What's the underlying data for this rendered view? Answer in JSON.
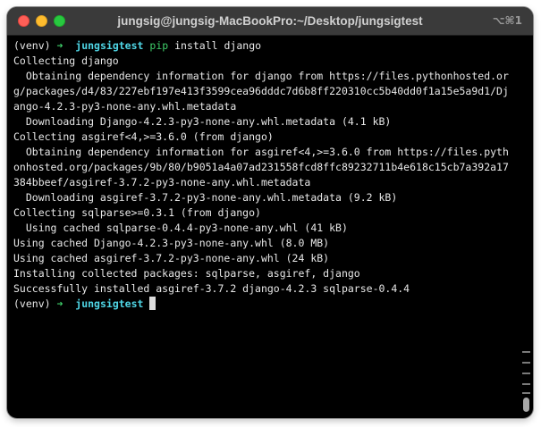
{
  "window": {
    "title": "jungsig@jungsig-MacBookPro:~/Desktop/jungsigtest",
    "shortcut": "⌥⌘1"
  },
  "terminal": {
    "prompt": {
      "venv": "(venv)",
      "arrow": "➜",
      "directory": "jungsigtest"
    },
    "command": {
      "program": "pip",
      "args": "install django"
    },
    "output": [
      "Collecting django",
      "  Obtaining dependency information for django from https://files.pythonhosted.or",
      "g/packages/d4/83/227ebf197e413f3599cea96dddc7d6b8ff220310cc5b40dd0f1a15e5a9d1/Dj",
      "ango-4.2.3-py3-none-any.whl.metadata",
      "  Downloading Django-4.2.3-py3-none-any.whl.metadata (4.1 kB)",
      "Collecting asgiref<4,>=3.6.0 (from django)",
      "  Obtaining dependency information for asgiref<4,>=3.6.0 from https://files.pyth",
      "onhosted.org/packages/9b/80/b9051a4a07ad231558fcd8ffc89232711b4e618c15cb7a392a17",
      "384bbeef/asgiref-3.7.2-py3-none-any.whl.metadata",
      "  Downloading asgiref-3.7.2-py3-none-any.whl.metadata (9.2 kB)",
      "Collecting sqlparse>=0.3.1 (from django)",
      "  Using cached sqlparse-0.4.4-py3-none-any.whl (41 kB)",
      "Using cached Django-4.2.3-py3-none-any.whl (8.0 MB)",
      "Using cached asgiref-3.7.2-py3-none-any.whl (24 kB)",
      "Installing collected packages: sqlparse, asgiref, django",
      "Successfully installed asgiref-3.7.2 django-4.2.3 sqlparse-0.4.4"
    ]
  },
  "colors": {
    "titlebar": "#3a3a3a",
    "background": "#000000",
    "text": "#e8e8e8",
    "prompt_arrow": "#3fcf6a",
    "prompt_directory": "#4fd6e6",
    "close": "#fe5f57",
    "minimize": "#febc2e",
    "zoom": "#28c840"
  }
}
